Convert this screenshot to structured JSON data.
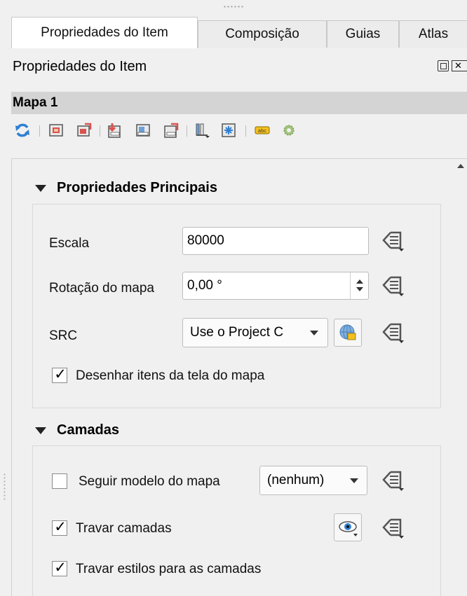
{
  "tabs": [
    {
      "label": "Propriedades do Item",
      "active": true
    },
    {
      "label": "Composição",
      "active": false
    },
    {
      "label": "Guias",
      "active": false
    },
    {
      "label": "Atlas",
      "active": false
    }
  ],
  "panel": {
    "title": "Propriedades do Item",
    "float_icon": "float-dock-icon",
    "close_icon": "close-dock-icon"
  },
  "item": {
    "name": "Mapa 1"
  },
  "toolbar": {
    "icons": [
      "refresh-preview-icon",
      "set-extent-to-canvas-icon",
      "view-extent-in-canvas-icon",
      "set-scale-to-canvas-icon",
      "set-canvas-scale-icon",
      "view-scale-in-canvas-icon",
      "bookmarks-icon",
      "atlas-settings-icon",
      "labeling-settings-icon",
      "clipping-settings-icon"
    ]
  },
  "main_properties": {
    "title": "Propriedades Principais",
    "scale_label": "Escala",
    "scale_value": "80000",
    "rotation_label": "Rotação do mapa",
    "rotation_value": "0,00 °",
    "crs_label": "SRC",
    "crs_value": "Use o Project C",
    "draw_items_label": "Desenhar itens da tela do mapa",
    "draw_items_checked": true
  },
  "layers": {
    "title": "Camadas",
    "follow_theme_label": "Seguir modelo do mapa",
    "follow_theme_checked": false,
    "theme_value": "(nenhum)",
    "lock_layers_label": "Travar camadas",
    "lock_layers_checked": true,
    "lock_styles_label": "Travar estilos para as camadas",
    "lock_styles_checked": true
  },
  "marks": {
    "checked": "✓",
    "close_glyph": "✕"
  },
  "colors": {
    "accent_blue": "#2f7fd3",
    "header_gray": "#d4d4d4",
    "data_defined_icon": "#555555"
  }
}
